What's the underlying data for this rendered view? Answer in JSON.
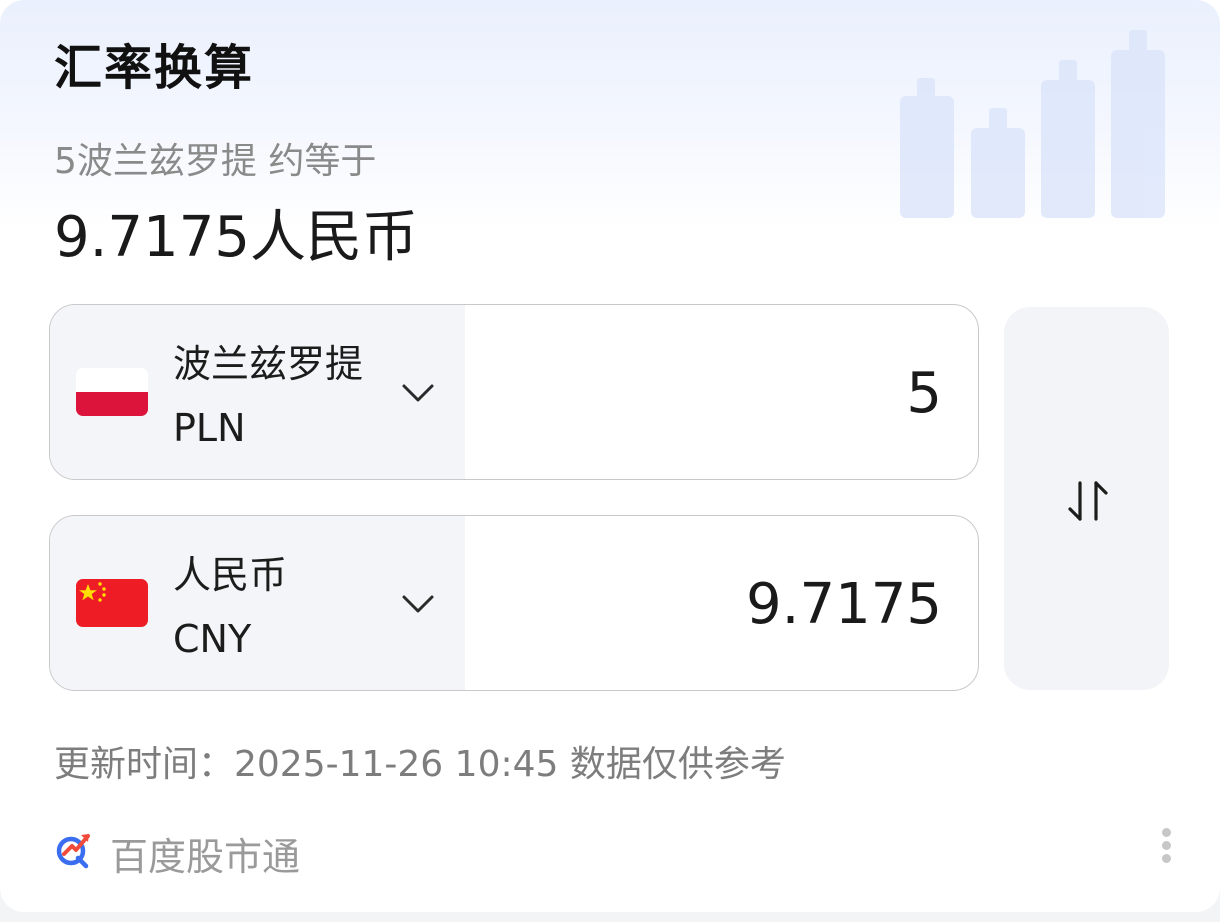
{
  "card": {
    "title": "汇率换算",
    "subtitle": "5波兰兹罗提 约等于",
    "result": "9.7175人民币"
  },
  "converter": {
    "from": {
      "name": "波兰兹罗提",
      "code": "PLN",
      "amount": "5",
      "flag": "poland-flag-icon"
    },
    "to": {
      "name": "人民币",
      "code": "CNY",
      "amount": "9.7175",
      "flag": "china-flag-icon"
    },
    "swap_icon": "swap-arrows-icon",
    "dropdown_icon": "chevron-down-icon"
  },
  "update_text": "更新时间：2025-11-26 10:45 数据仅供参考",
  "footer": {
    "brand": "百度股市通",
    "brand_icon": "baidu-stock-logo-icon",
    "more_icon": "more-vertical-icon"
  },
  "colors": {
    "accent_blue": "#3b6df0",
    "flag_red_pl": "#dc143c",
    "flag_red_cn": "#ee1c25",
    "flag_star": "#ffde00"
  }
}
